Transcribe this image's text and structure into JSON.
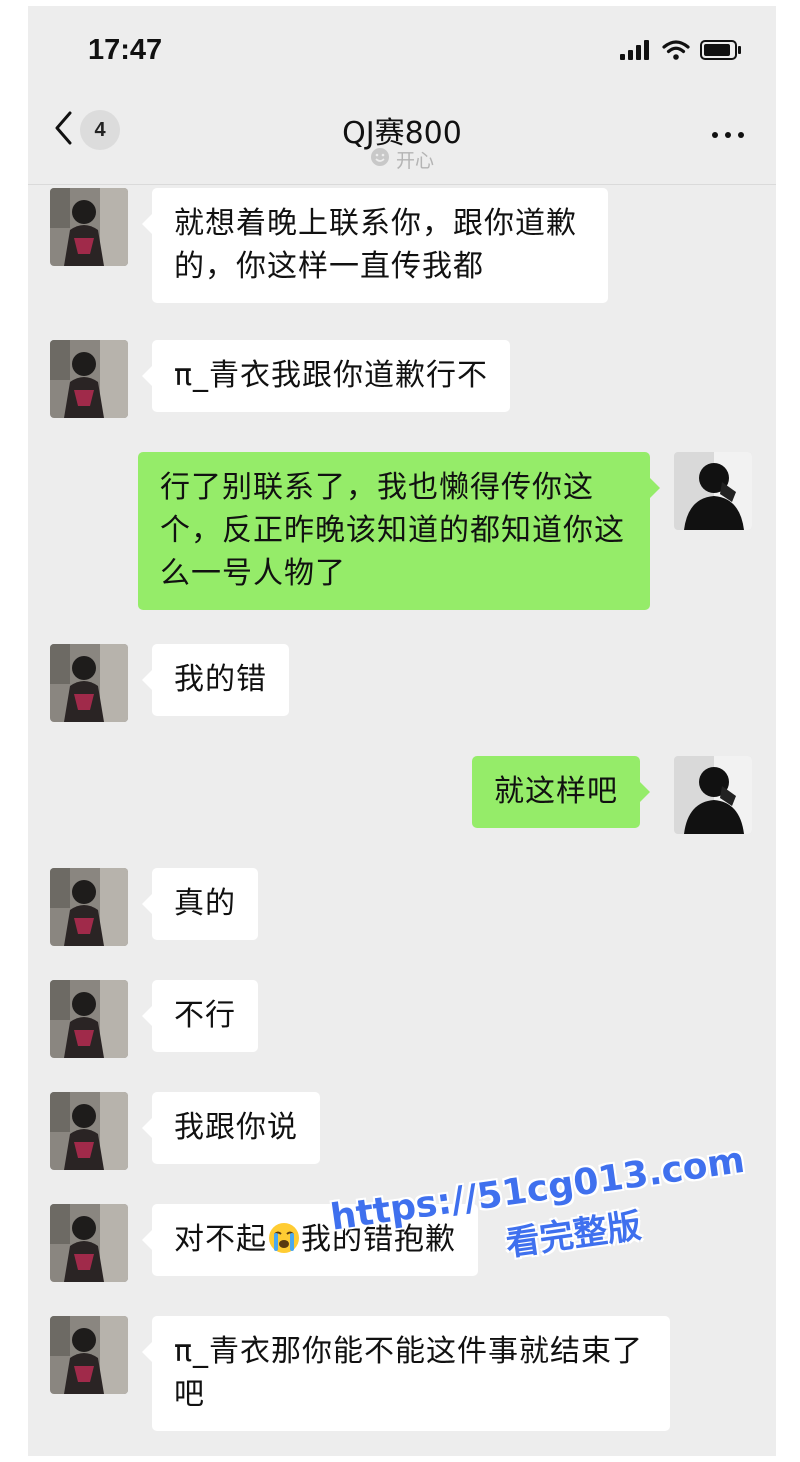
{
  "status_bar": {
    "time": "17:47"
  },
  "nav": {
    "back_count": "4",
    "title": "QJ赛800",
    "status": "开心"
  },
  "messages": [
    {
      "side": "left",
      "text": "就想着晚上联系你，跟你道歉的，你这样一直传我都"
    },
    {
      "side": "left",
      "text": "π_青衣我跟你道歉行不"
    },
    {
      "side": "right",
      "text": "行了别联系了，我也懒得传你这个，反正昨晚该知道的都知道你这么一号人物了"
    },
    {
      "side": "left",
      "text": "我的错"
    },
    {
      "side": "right",
      "text": "就这样吧"
    },
    {
      "side": "left",
      "text": "真的"
    },
    {
      "side": "left",
      "text": "不行"
    },
    {
      "side": "left",
      "text": "我跟你说"
    },
    {
      "side": "left",
      "text_before": "对不起",
      "emoji": "crying-face",
      "text_after": "我的错抱歉"
    },
    {
      "side": "left",
      "text": "π_青衣那你能不能这件事就结束了吧"
    }
  ],
  "watermark": {
    "url": "https://51cg013.com",
    "caption": "看完整版"
  },
  "colors": {
    "chat_bg": "#ededed",
    "bubble_self": "#95ec69",
    "bubble_other": "#ffffff",
    "watermark": "#3f70ee"
  }
}
